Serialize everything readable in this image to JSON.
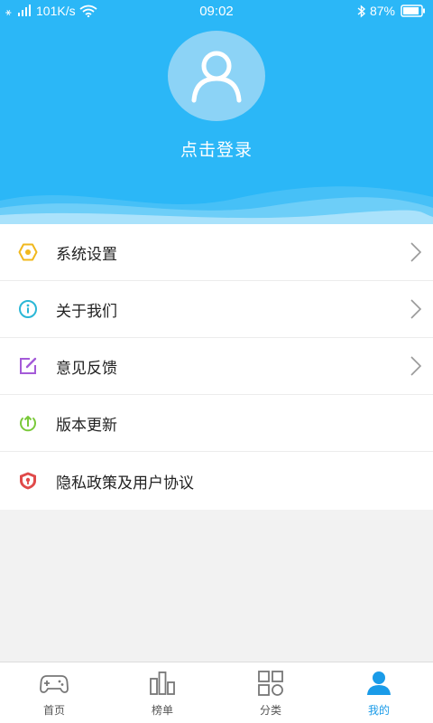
{
  "status_bar": {
    "network_speed": "101K/s",
    "time": "09:02",
    "battery_percent": "87%",
    "icons": [
      "signal-icon",
      "wifi-icon",
      "bluetooth-icon",
      "battery-icon"
    ]
  },
  "profile": {
    "login_label": "点击登录",
    "avatar_icon": "user-avatar-icon"
  },
  "menu": {
    "items": [
      {
        "label": "系统设置",
        "icon": "settings-hexagon-icon",
        "icon_color": "#f1b81d",
        "has_arrow": true
      },
      {
        "label": "关于我们",
        "icon": "info-icon",
        "icon_color": "#2bb7d6",
        "has_arrow": true
      },
      {
        "label": "意见反馈",
        "icon": "edit-feedback-icon",
        "icon_color": "#a45ad8",
        "has_arrow": true
      },
      {
        "label": "版本更新",
        "icon": "upload-update-icon",
        "icon_color": "#7ac93a",
        "has_arrow": false
      },
      {
        "label": "隐私政策及用户协议",
        "icon": "shield-icon",
        "icon_color": "#e04a4a",
        "has_arrow": false
      }
    ]
  },
  "tabbar": {
    "tabs": [
      {
        "label": "首页",
        "icon": "gamepad-icon",
        "active": false
      },
      {
        "label": "榜单",
        "icon": "bar-chart-icon",
        "active": false
      },
      {
        "label": "分类",
        "icon": "grid-icon",
        "active": false
      },
      {
        "label": "我的",
        "icon": "person-icon",
        "active": true
      }
    ]
  },
  "colors": {
    "header_bg": "#2bb7f7",
    "active_tab": "#1a9be8"
  }
}
